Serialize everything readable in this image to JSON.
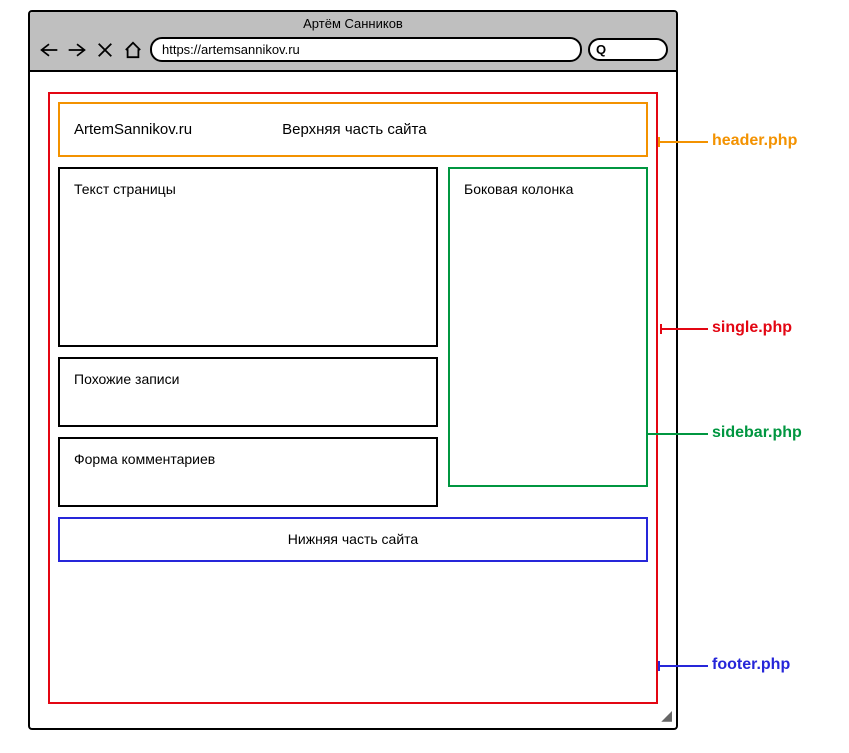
{
  "browser": {
    "title": "Артём Санников",
    "url": "https://artemsannikov.ru",
    "search_glyph": "Q"
  },
  "header": {
    "site_name": "ArtemSannikov.ru",
    "caption": "Верхняя часть сайта"
  },
  "content": {
    "page_text": "Текст страницы",
    "related": "Похожие записи",
    "comments": "Форма комментариев"
  },
  "sidebar": {
    "title": "Боковая колонка"
  },
  "footer": {
    "caption": "Нижняя часть сайта"
  },
  "annotations": {
    "header": "header.php",
    "single": "single.php",
    "sidebar": "sidebar.php",
    "footer": "footer.php"
  },
  "colors": {
    "orange": "#f39200",
    "red": "#e30613",
    "green": "#009640",
    "blue": "#2626d9"
  }
}
